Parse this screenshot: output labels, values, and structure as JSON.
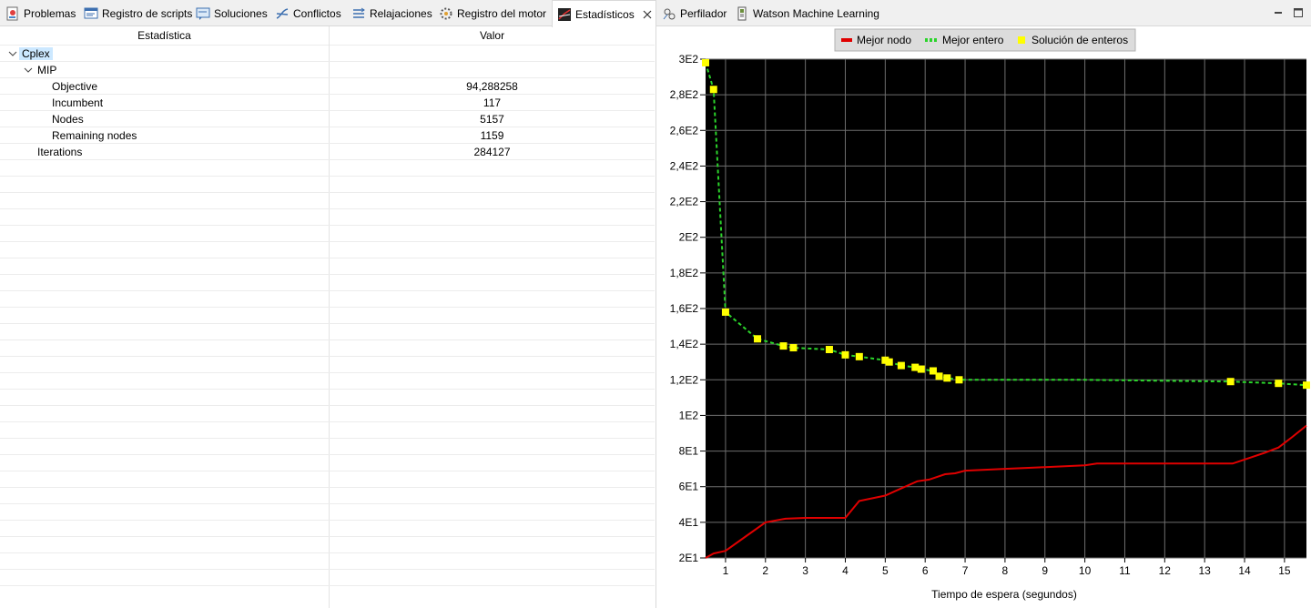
{
  "left_tabs": [
    {
      "label": "Problemas",
      "icon": "problems-icon"
    },
    {
      "label": "Registro de scripts",
      "icon": "script-log-icon"
    },
    {
      "label": "Soluciones",
      "icon": "solutions-icon"
    },
    {
      "label": "Conflictos",
      "icon": "conflicts-icon"
    },
    {
      "label": "Relajaciones",
      "icon": "relaxations-icon"
    },
    {
      "label": "Registro del motor",
      "icon": "engine-log-icon"
    },
    {
      "label": "Estadísticos",
      "icon": "statistics-icon",
      "active": true
    }
  ],
  "right_tabs": [
    {
      "label": "Perfilador",
      "icon": "profiler-icon"
    },
    {
      "label": "Watson Machine Learning",
      "icon": "watson-icon"
    }
  ],
  "table": {
    "col_name": "Estadística",
    "col_value": "Valor",
    "rows": [
      {
        "name": "Cplex",
        "value": ""
      },
      {
        "name": "MIP",
        "value": ""
      },
      {
        "name": "Objective",
        "value": "94,288258"
      },
      {
        "name": "Incumbent",
        "value": "117"
      },
      {
        "name": "Nodes",
        "value": "5157"
      },
      {
        "name": "Remaining nodes",
        "value": "1159"
      },
      {
        "name": "Iterations",
        "value": "284127"
      }
    ]
  },
  "chart_data": {
    "type": "line",
    "xlabel": "Tiempo de espera (segundos)",
    "ylabel": "",
    "xlim": [
      0.5,
      15.55
    ],
    "ylim": [
      20,
      300
    ],
    "x_ticks": [
      1,
      2,
      3,
      4,
      5,
      6,
      7,
      8,
      9,
      10,
      11,
      12,
      13,
      14,
      15
    ],
    "y_ticks": [
      20,
      40,
      60,
      80,
      100,
      120,
      140,
      160,
      180,
      200,
      220,
      240,
      260,
      280,
      300
    ],
    "y_tick_labels": [
      "2E1",
      "4E1",
      "6E1",
      "8E1",
      "1E2",
      "1,2E2",
      "1,4E2",
      "1,6E2",
      "1,8E2",
      "2E2",
      "2,2E2",
      "2,4E2",
      "2,6E2",
      "2,8E2",
      "3E2"
    ],
    "grid": true,
    "background": "#000000",
    "legend_position": "top",
    "series": [
      {
        "name": "Mejor nodo",
        "style": "solid",
        "color": "#e00000",
        "x": [
          0.5,
          0.7,
          1.0,
          1.5,
          2.0,
          2.5,
          3.0,
          3.5,
          4.0,
          4.35,
          5.0,
          5.3,
          5.8,
          6.1,
          6.5,
          6.75,
          7.0,
          8.0,
          9.0,
          10.0,
          10.3,
          11.0,
          12.0,
          13.0,
          13.7,
          14.1,
          14.5,
          14.85,
          15.2,
          15.55
        ],
        "y": [
          20,
          22.5,
          24,
          32,
          40,
          42,
          42.5,
          42.5,
          42.5,
          52,
          55,
          58,
          63,
          64,
          67,
          67.5,
          69,
          70,
          71,
          72,
          73,
          73,
          73,
          73,
          73,
          76,
          79,
          82,
          88,
          94.3
        ]
      },
      {
        "name": "Mejor entero",
        "style": "dashed",
        "color": "#2bd42b",
        "x": [
          0.5,
          0.7,
          1.0,
          1.8,
          2.45,
          2.7,
          3.6,
          4.0,
          4.35,
          5.0,
          5.1,
          5.4,
          5.75,
          5.9,
          6.2,
          6.35,
          6.55,
          6.85,
          10.0,
          13.65,
          14.85,
          15.55
        ],
        "y": [
          298,
          283,
          158,
          143,
          139,
          138,
          137,
          134,
          133,
          131,
          130,
          128,
          127,
          126,
          125,
          122,
          121,
          120,
          120,
          119,
          118,
          117
        ]
      },
      {
        "name": "Solución de enteros",
        "style": "markers",
        "color": "#ffff00",
        "x": [
          0.5,
          0.7,
          1.0,
          1.8,
          2.45,
          2.7,
          3.6,
          4.0,
          4.35,
          5.0,
          5.1,
          5.4,
          5.75,
          5.9,
          6.2,
          6.35,
          6.55,
          6.85,
          13.65,
          14.85,
          15.55
        ],
        "y": [
          298,
          283,
          158,
          143,
          139,
          138,
          137,
          134,
          133,
          131,
          130,
          128,
          127,
          126,
          125,
          122,
          121,
          120,
          119,
          118,
          117
        ]
      }
    ]
  }
}
